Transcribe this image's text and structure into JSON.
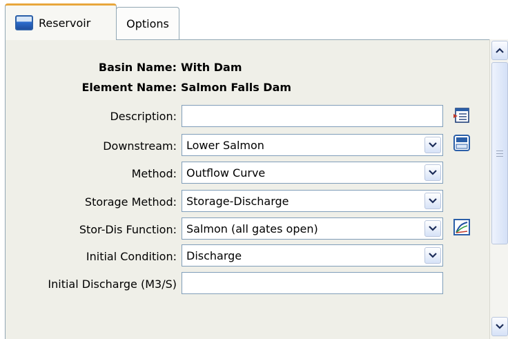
{
  "tabs": [
    {
      "label": "Reservoir",
      "active": true
    },
    {
      "label": "Options",
      "active": false
    }
  ],
  "header": {
    "basin_name_label": "Basin Name:",
    "basin_name_value": "With Dam",
    "element_name_label": "Element Name:",
    "element_name_value": "Salmon Falls Dam"
  },
  "fields": {
    "description": {
      "label": "Description:",
      "value": ""
    },
    "downstream": {
      "label": "Downstream:",
      "value": "Lower Salmon"
    },
    "method": {
      "label": "Method:",
      "value": "Outflow Curve"
    },
    "storage_method": {
      "label": "Storage Method:",
      "value": "Storage-Discharge"
    },
    "stor_dis_function": {
      "label": "Stor-Dis Function:",
      "value": "Salmon (all gates open)"
    },
    "initial_condition": {
      "label": "Initial Condition:",
      "value": "Discharge"
    },
    "initial_discharge": {
      "label": "Initial Discharge (M3/S)",
      "value": ""
    }
  },
  "icons": {
    "reservoir_tab": "reservoir-icon",
    "description_button": "edit-description-icon",
    "downstream_button": "select-element-icon",
    "stor_dis_button": "curve-chart-icon",
    "dropdown": "chevron-down-icon",
    "scroll_up": "chevron-up-icon",
    "scroll_down": "chevron-down-icon"
  },
  "colors": {
    "panel_bg": "#efefe8",
    "active_tab_accent": "#e8a63c",
    "field_border": "#7f9db9",
    "icon_blue": "#2b5fa8"
  }
}
